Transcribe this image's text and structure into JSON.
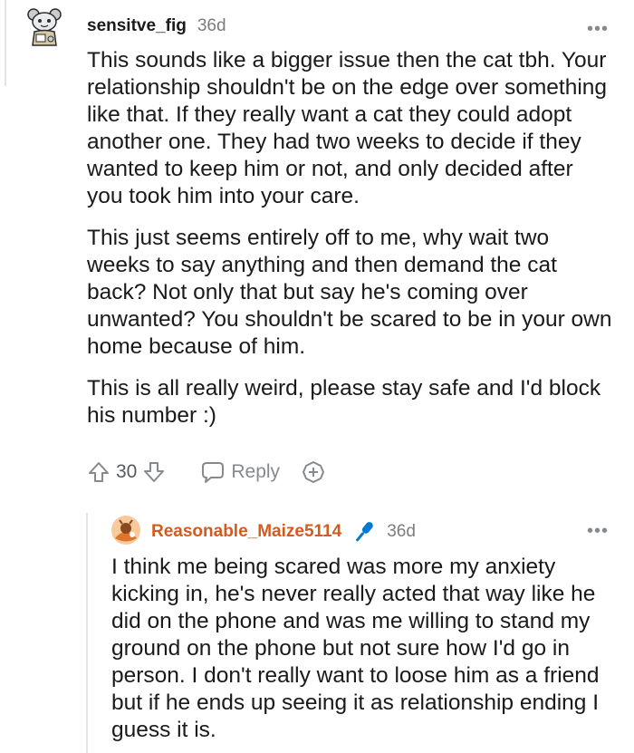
{
  "comment": {
    "username": "sensitve_fig",
    "time": "36d",
    "more_label": "•••",
    "paragraphs": [
      "This sounds like a bigger issue then the cat tbh. Your relationship shouldn't be on the edge over something like that. If they really want a cat they could adopt another one. They had two weeks to decide if they wanted to keep him or not, and only decided after you took him into your care.",
      "This just seems entirely off to me, why wait two weeks to say anything and then demand the cat back? Not only that but say he's coming over unwanted? You shouldn't be scared to be in your own home because of him.",
      "This is all really weird, please stay safe and I'd block his number :)"
    ],
    "score": "30",
    "reply_label": "Reply",
    "icons": {
      "avatar": "snoo-avatar-icon",
      "upvote": "upvote-arrow-icon",
      "downvote": "downvote-arrow-icon",
      "reply": "speech-bubble-icon",
      "award": "plus-award-icon"
    }
  },
  "reply": {
    "username": "Reasonable_Maize5114",
    "time": "36d",
    "more_label": "•••",
    "text": "I think me being scared was more my anxiety kicking in, he's never really acted that way like he did on the phone and was me willing to stand my ground on the phone but not sure how I'd go in person. I don't really want to loose him as a friend but if he ends up seeing it as relationship ending I guess it is.",
    "icons": {
      "avatar": "orange-avatar-icon",
      "op_badge": "microphone-icon"
    }
  },
  "colors": {
    "op_username": "#d45b1e",
    "mic_blue": "#0079d3",
    "muted": "#878a8c"
  }
}
